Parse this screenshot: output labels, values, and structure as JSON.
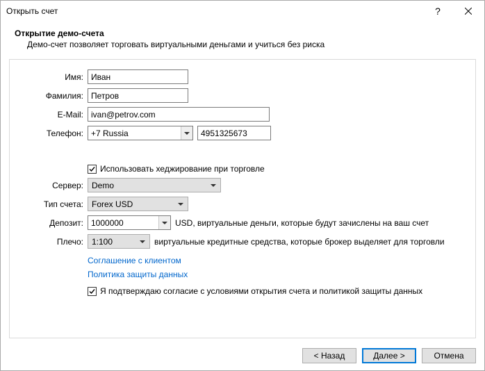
{
  "window": {
    "title": "Открыть счет"
  },
  "header": {
    "title": "Открытие демо-счета",
    "subtitle": "Демо-счет позволяет торговать виртуальными деньгами и учиться без риска"
  },
  "form": {
    "name_label": "Имя:",
    "name_value": "Иван",
    "surname_label": "Фамилия:",
    "surname_value": "Петров",
    "email_label": "E-Mail:",
    "email_value": "ivan@petrov.com",
    "phone_label": "Телефон:",
    "phone_code": "+7 Russia",
    "phone_value": "4951325673",
    "hedge_label": "Использовать хеджирование при торговле",
    "server_label": "Сервер:",
    "server_value": "Demo",
    "type_label": "Тип счета:",
    "type_value": "Forex USD",
    "deposit_label": "Депозит:",
    "deposit_value": "1000000",
    "deposit_note": "USD, виртуальные деньги, которые будут зачислены на ваш счет",
    "leverage_label": "Плечо:",
    "leverage_value": "1:100",
    "leverage_note": "виртуальные кредитные средства, которые брокер выделяет для торговли",
    "agreement_link": "Соглашение с клиентом",
    "privacy_link": "Политика защиты данных",
    "confirm_label": "Я подтверждаю согласие с условиями открытия счета и политикой защиты данных"
  },
  "footer": {
    "back": "< Назад",
    "next": "Далее >",
    "cancel": "Отмена"
  }
}
